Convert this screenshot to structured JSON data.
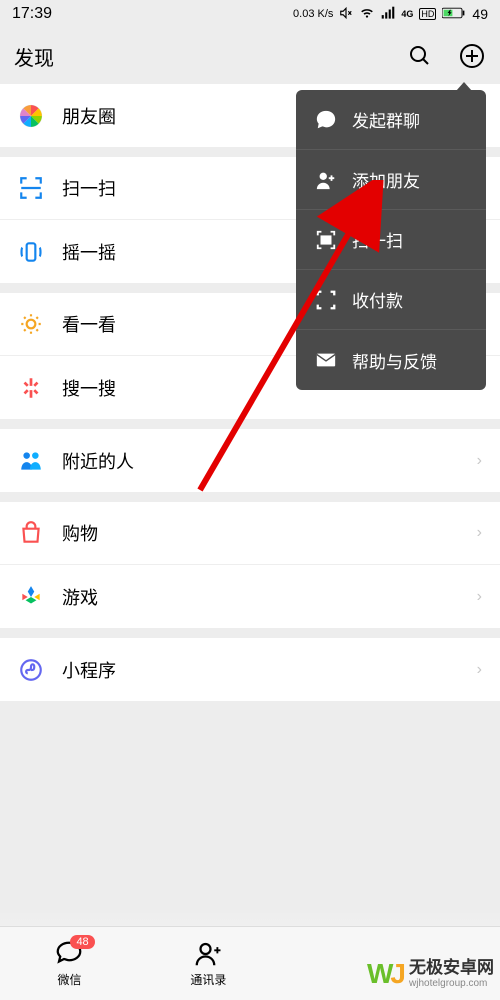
{
  "status": {
    "time": "17:39",
    "speed": "0.03 K/s",
    "battery": "49"
  },
  "header": {
    "title": "发现"
  },
  "groups": [
    {
      "items": [
        {
          "id": "moments",
          "label": "朋友圈",
          "chevron": false
        }
      ]
    },
    {
      "items": [
        {
          "id": "scan",
          "label": "扫一扫",
          "chevron": false
        },
        {
          "id": "shake",
          "label": "摇一摇",
          "chevron": false
        }
      ]
    },
    {
      "items": [
        {
          "id": "look",
          "label": "看一看",
          "chevron": false
        },
        {
          "id": "search-sou",
          "label": "搜一搜",
          "chevron": false
        }
      ]
    },
    {
      "items": [
        {
          "id": "nearby",
          "label": "附近的人",
          "chevron": true
        }
      ]
    },
    {
      "items": [
        {
          "id": "shopping",
          "label": "购物",
          "chevron": true
        },
        {
          "id": "games",
          "label": "游戏",
          "chevron": true
        }
      ]
    },
    {
      "items": [
        {
          "id": "miniprogram",
          "label": "小程序",
          "chevron": true
        }
      ]
    }
  ],
  "popup": {
    "items": [
      {
        "id": "group-chat",
        "label": "发起群聊"
      },
      {
        "id": "add-friend",
        "label": "添加朋友"
      },
      {
        "id": "scan-qr",
        "label": "扫一扫"
      },
      {
        "id": "payment",
        "label": "收付款"
      },
      {
        "id": "help",
        "label": "帮助与反馈"
      }
    ]
  },
  "nav": {
    "items": [
      {
        "id": "wechat",
        "label": "微信",
        "badge": "48"
      },
      {
        "id": "contacts",
        "label": "通讯录"
      }
    ]
  },
  "watermark": {
    "cn": "无极安卓网",
    "en": "wjhotelgroup.com"
  }
}
